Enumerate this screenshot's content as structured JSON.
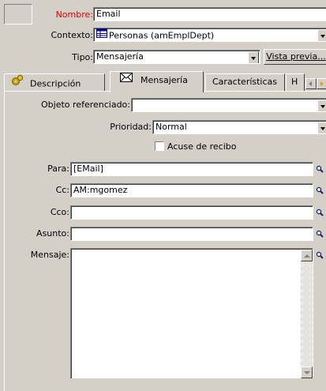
{
  "header": {
    "nombre_label": "Nombre:",
    "nombre_value": "Email",
    "contexto_label": "Contexto:",
    "contexto_value": "Personas (amEmplDept)",
    "tipo_label": "Tipo:",
    "tipo_value": "Mensajería",
    "vista_previa_label": "Vista previa..."
  },
  "tabs": [
    {
      "label": "Descripción",
      "icon": "gears-icon"
    },
    {
      "label": "Mensajería",
      "icon": "envelope-icon"
    },
    {
      "label": "Características"
    },
    {
      "label": "H"
    }
  ],
  "mensajeria": {
    "objeto_label": "Objeto referenciado:",
    "objeto_value": "",
    "prioridad_label": "Prioridad:",
    "prioridad_value": "Normal",
    "acuse_label": "Acuse de recibo",
    "acuse_checked": false,
    "para_label": "Para:",
    "para_value": "[EMail]",
    "cc_label": "Cc:",
    "cc_value": "AM:mgomez",
    "cco_label": "Cco:",
    "cco_value": "",
    "asunto_label": "Asunto:",
    "asunto_value": "",
    "mensaje_label": "Mensaje:",
    "mensaje_value": ""
  },
  "colors": {
    "required_label": "#e00000",
    "window_bg": "#d4d0c8",
    "dither": "#ffffff"
  }
}
